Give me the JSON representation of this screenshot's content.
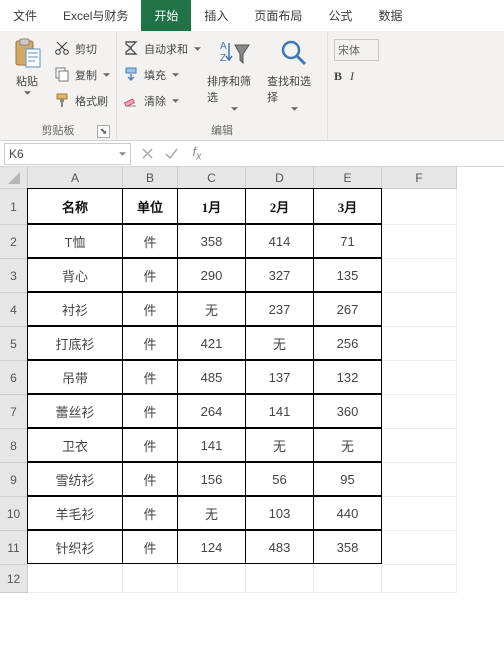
{
  "tabs": {
    "t0": "文件",
    "t1": "Excel与财务",
    "t2": "开始",
    "t3": "插入",
    "t4": "页面布局",
    "t5": "公式",
    "t6": "数据"
  },
  "clipboard": {
    "paste": "粘贴",
    "cut": "剪切",
    "copy": "复制",
    "format": "格式刷",
    "group": "剪贴板"
  },
  "editing": {
    "sum": "自动求和",
    "fill": "填充",
    "clear": "清除",
    "sort": "排序和筛选",
    "find": "查找和选择",
    "group": "编辑"
  },
  "font": {
    "name": "宋体",
    "bold": "B",
    "italic": "I"
  },
  "namebox": "K6",
  "cols": [
    "A",
    "B",
    "C",
    "D",
    "E",
    "F"
  ],
  "rows": [
    "1",
    "2",
    "3",
    "4",
    "5",
    "6",
    "7",
    "8",
    "9",
    "10",
    "11",
    "12"
  ],
  "hdr": {
    "a": "名称",
    "b": "单位",
    "c": "1月",
    "d": "2月",
    "e": "3月"
  },
  "data": [
    {
      "a": "T恤",
      "b": "件",
      "c": "358",
      "d": "414",
      "e": "71"
    },
    {
      "a": "背心",
      "b": "件",
      "c": "290",
      "d": "327",
      "e": "135"
    },
    {
      "a": "衬衫",
      "b": "件",
      "c": "无",
      "d": "237",
      "e": "267"
    },
    {
      "a": "打底衫",
      "b": "件",
      "c": "421",
      "d": "无",
      "e": "256"
    },
    {
      "a": "吊带",
      "b": "件",
      "c": "485",
      "d": "137",
      "e": "132"
    },
    {
      "a": "蕾丝衫",
      "b": "件",
      "c": "264",
      "d": "141",
      "e": "360"
    },
    {
      "a": "卫衣",
      "b": "件",
      "c": "141",
      "d": "无",
      "e": "无"
    },
    {
      "a": "雪纺衫",
      "b": "件",
      "c": "156",
      "d": "56",
      "e": "95"
    },
    {
      "a": "羊毛衫",
      "b": "件",
      "c": "无",
      "d": "103",
      "e": "440"
    },
    {
      "a": "针织衫",
      "b": "件",
      "c": "124",
      "d": "483",
      "e": "358"
    }
  ]
}
